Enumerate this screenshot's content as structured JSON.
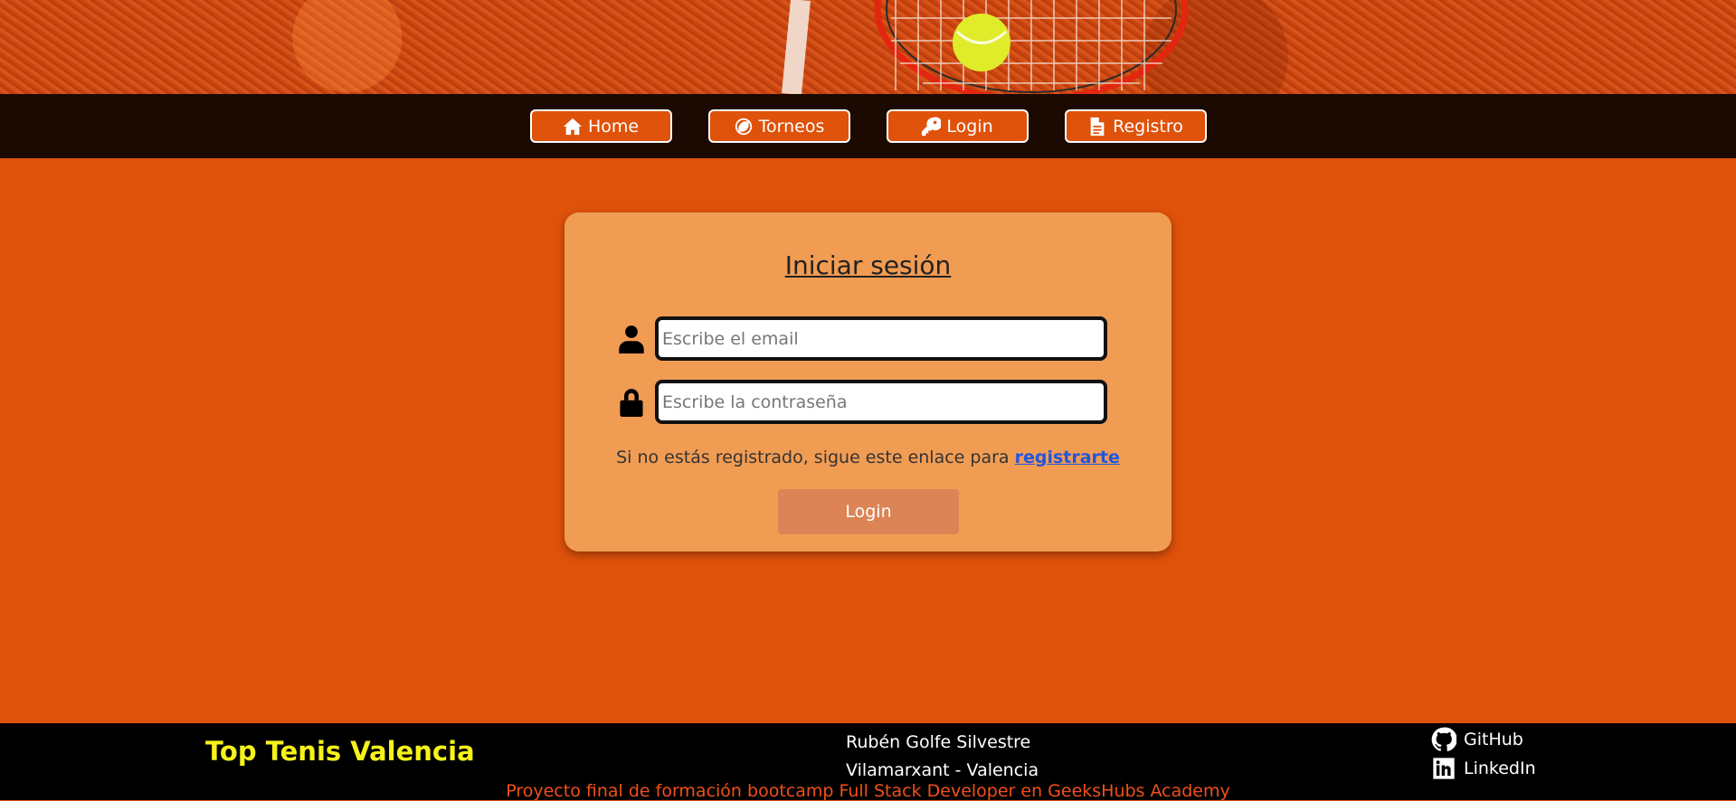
{
  "nav": {
    "items": [
      {
        "label": "Home",
        "icon": "home-icon"
      },
      {
        "label": "Torneos",
        "icon": "tennis-ball-icon"
      },
      {
        "label": "Login",
        "icon": "key-icon"
      },
      {
        "label": "Registro",
        "icon": "document-icon"
      }
    ]
  },
  "login": {
    "title": "Iniciar sesión",
    "email_placeholder": "Escribe el email",
    "email_value": "",
    "password_placeholder": "Escribe la contraseña",
    "password_value": "",
    "hint_text": "Si no estás registrado, sigue este enlace para ",
    "hint_link": "registrarte",
    "submit_label": "Login"
  },
  "footer": {
    "brand": "Top Tenis Valencia",
    "author_name": "Rubén Golfe Silvestre",
    "author_location": "Vilamarxant - Valencia",
    "github_label": "GitHub",
    "linkedin_label": "LinkedIn",
    "note": "Proyecto final de formación bootcamp Full Stack Developer en GeeksHubs Academy"
  },
  "colors": {
    "page_bg": "#df520a",
    "nav_bg": "#1b0902",
    "card_bg": "#f19c53",
    "brand_yellow": "#f7f21a",
    "link_blue": "#2255dd"
  }
}
